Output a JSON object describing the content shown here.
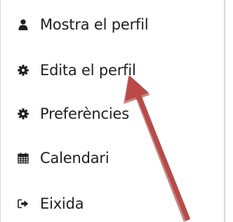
{
  "user_menu": {
    "items": [
      {
        "label": "Mostra el perfil",
        "icon": "user-icon"
      },
      {
        "label": "Edita el perfil",
        "icon": "gear-icon"
      },
      {
        "label": "Preferències",
        "icon": "gear-icon"
      },
      {
        "label": "Calendari",
        "icon": "calendar-icon"
      },
      {
        "label": "Eixida",
        "icon": "sign-out-icon"
      }
    ]
  },
  "annotation": {
    "arrow_color": "#b94a48",
    "points_to": "Edita el perfil"
  }
}
